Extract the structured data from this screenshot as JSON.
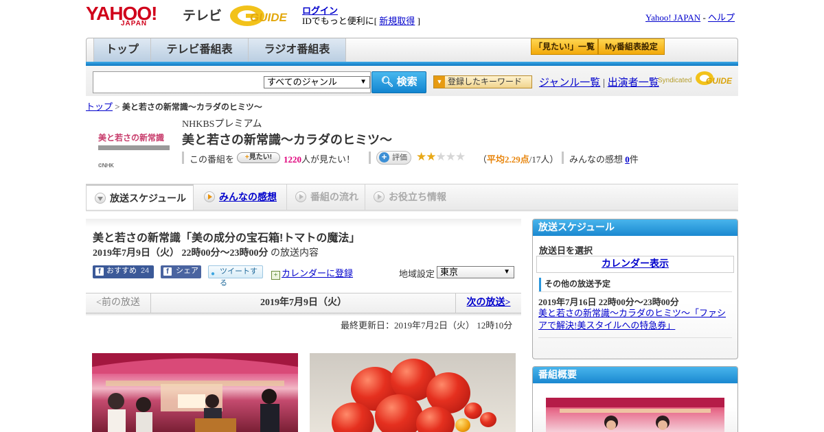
{
  "header": {
    "logo_yahoo": "YAHOO!",
    "logo_japan": "JAPAN",
    "logo_tv": "テレビ",
    "logo_gguide": "GUIDE",
    "login": "ログイン",
    "login_note_prefix": "IDでもっと便利に[",
    "signup": "新規取得",
    "login_note_suffix": "]",
    "yahoo_japan": "Yahoo! JAPAN",
    "separator": "-",
    "help": "ヘルプ"
  },
  "nav": {
    "tabs": [
      "トップ",
      "テレビ番組表",
      "ラジオ番組表"
    ],
    "mitai_list": "「見たい!」一覧",
    "my_settings": "My番組表設定"
  },
  "search": {
    "genre_selected": "すべてのジャンル",
    "button": "検索",
    "keyword_button": "登録したキーワード",
    "genre_list": "ジャンル一覧",
    "link_sep": "|",
    "performer_list": "出演者一覧",
    "syndicated": "Syndicated",
    "synd_logo": "GUIDE"
  },
  "breadcrumb": {
    "top": "トップ",
    "sep": ">",
    "current": "美と若さの新常識～カラダのヒミツ～"
  },
  "program": {
    "logo_title": "美と若さの新常識",
    "logo_credit": "©NHK",
    "channel": "NHKBSプレミアム",
    "title": "美と若さの新常識～カラダのヒミツ～",
    "mitai_prefix": "この番組を",
    "mitai_button": "見たい!",
    "mitai_count": "1220",
    "mitai_suffix": "人が見たい！",
    "rate_button": "評価",
    "rating_value": 2.29,
    "rating_open": "（",
    "rating_avg": "平均2.29点",
    "rating_votes": "/17人）",
    "kansou_prefix": "みんなの感想",
    "kansou_count": "0",
    "kansou_suffix": "件"
  },
  "subtabs": {
    "schedule": "放送スケジュール",
    "kansou": "みんなの感想",
    "flow": "番組の流れ",
    "info": "お役立ち情報"
  },
  "episode": {
    "title": "美と若さの新常識「美の成分の宝石箱!トマトの魔法」",
    "time": "2019年7月9日（火） 22時00分～23時00分",
    "time_suffix": "の放送内容",
    "fb_recommend": "おすすめ",
    "fb_count": "24",
    "fb_share": "シェア",
    "tweet": "ツイートする",
    "calendar_register": "カレンダーに登録",
    "region_label": "地域設定",
    "region_selected": "東京",
    "prev": "<前の放送",
    "current_date": "2019年7月9日（火）",
    "next": "次の放送>",
    "updated": "最終更新日：2019年7月2日（火） 12時10分"
  },
  "sidebar": {
    "schedule_title": "放送スケジュール",
    "select_date": "放送日を選択",
    "calendar_show": "カレンダー表示",
    "other_title": "その他の放送予定",
    "other_time": "2019年7月16日 22時00分～23時00分",
    "other_link": "美と若さの新常識～カラダのヒミツ～「ファシアで解決!美スタイルへの特急券」",
    "summary_title": "番組概要"
  }
}
